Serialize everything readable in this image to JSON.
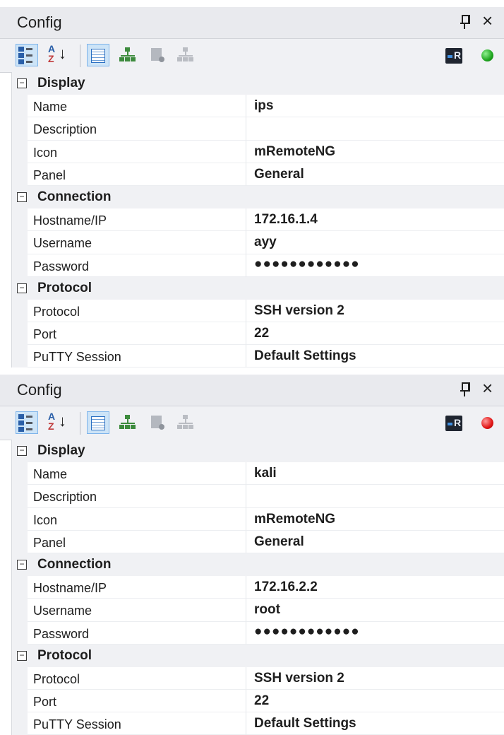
{
  "panels": [
    {
      "title": "Config",
      "status_color": "#1ea51e",
      "status": "connected",
      "sections": [
        {
          "label": "Display",
          "props": [
            {
              "name": "Name",
              "value": "ips"
            },
            {
              "name": "Description",
              "value": ""
            },
            {
              "name": "Icon",
              "value": "mRemoteNG"
            },
            {
              "name": "Panel",
              "value": "General"
            }
          ]
        },
        {
          "label": "Connection",
          "props": [
            {
              "name": "Hostname/IP",
              "value": "172.16.1.4"
            },
            {
              "name": "Username",
              "value": "ayy"
            },
            {
              "name": "Password",
              "value": "●●●●●●●●●●●●"
            }
          ]
        },
        {
          "label": "Protocol",
          "props": [
            {
              "name": "Protocol",
              "value": "SSH version 2"
            },
            {
              "name": "Port",
              "value": "22"
            },
            {
              "name": "PuTTY Session",
              "value": "Default Settings"
            }
          ]
        }
      ]
    },
    {
      "title": "Config",
      "status_color": "#e01515",
      "status": "disconnected",
      "sections": [
        {
          "label": "Display",
          "props": [
            {
              "name": "Name",
              "value": "kali"
            },
            {
              "name": "Description",
              "value": ""
            },
            {
              "name": "Icon",
              "value": "mRemoteNG"
            },
            {
              "name": "Panel",
              "value": "General"
            }
          ]
        },
        {
          "label": "Connection",
          "props": [
            {
              "name": "Hostname/IP",
              "value": "172.16.2.2"
            },
            {
              "name": "Username",
              "value": "root"
            },
            {
              "name": "Password",
              "value": "●●●●●●●●●●●●"
            }
          ]
        },
        {
          "label": "Protocol",
          "props": [
            {
              "name": "Protocol",
              "value": "SSH version 2"
            },
            {
              "name": "Port",
              "value": "22"
            },
            {
              "name": "PuTTY Session",
              "value": "Default Settings"
            }
          ]
        }
      ]
    }
  ],
  "toolbar_icons": [
    "categorized-view-icon",
    "alphabetical-sort-icon",
    "properties-grid-icon",
    "inheritance-tree-icon",
    "default-properties-icon",
    "default-inheritance-icon",
    "rdp-host-status-icon",
    "connection-status-icon"
  ],
  "window_icons": [
    "pin-icon",
    "close-icon"
  ]
}
